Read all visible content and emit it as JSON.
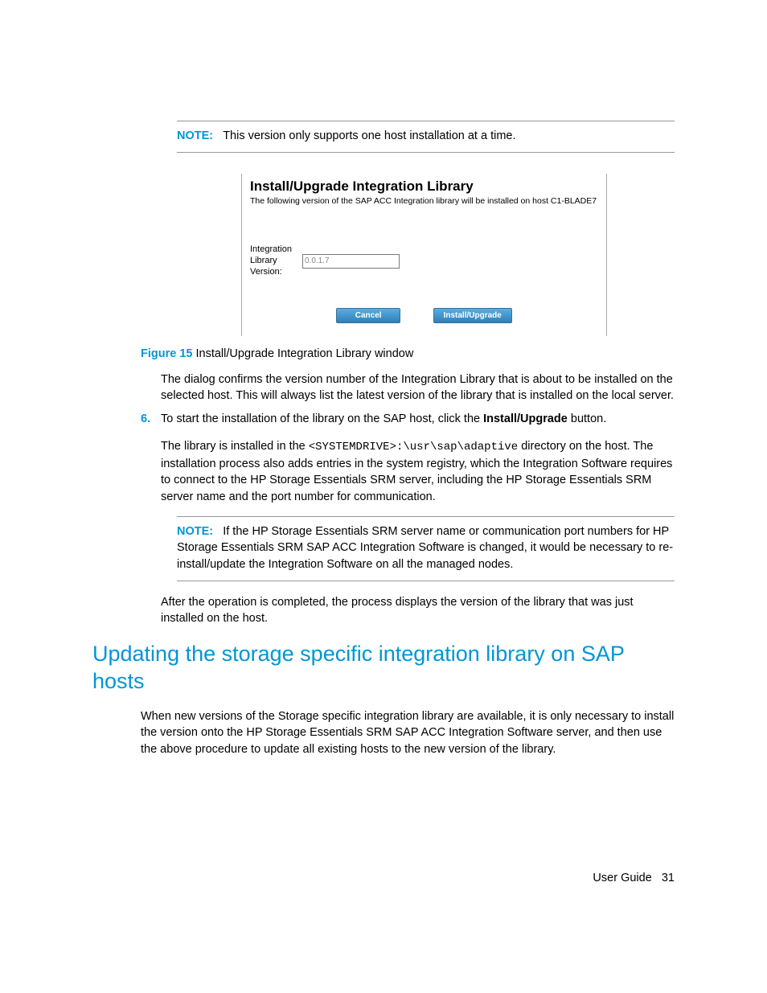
{
  "note1": {
    "label": "NOTE:",
    "text": "This version only supports one host installation at a time."
  },
  "figure": {
    "title": "Install/Upgrade Integration Library",
    "subtitle": "The following version of the SAP ACC Integration library will be installed on host C1-BLADE7",
    "field_label": "Integration Library Version:",
    "field_value": "0.0.1.7",
    "cancel_btn": "Cancel",
    "install_btn": "Install/Upgrade"
  },
  "caption": {
    "label": "Figure 15",
    "text": "Install/Upgrade Integration Library window"
  },
  "para_confirm": "The dialog confirms the version number of the Integration Library that is about to be installed on the selected host. This will always list the latest version of the library that is installed on the local server.",
  "step6": {
    "num": "6.",
    "text_a": "To start the installation of the library on the SAP host, click the ",
    "bold": "Install/Upgrade",
    "text_b": " button."
  },
  "para_install_a": "The library is installed in the ",
  "para_install_code": "<SYSTEMDRIVE>:\\usr\\sap\\adaptive",
  "para_install_b": " directory on the host. The installation process also adds entries in the system registry, which the Integration Software requires to connect to the HP Storage Essentials SRM server, including the HP Storage Essentials SRM server name and the port number for communication.",
  "note2": {
    "label": "NOTE:",
    "text": "If the HP Storage Essentials SRM server name or communication port numbers for HP Storage Essentials SRM SAP ACC Integration Software is changed, it would be necessary to re-install/update the Integration Software on all the managed nodes."
  },
  "para_after": "After the operation is completed, the process displays the version of the library that was just installed on the host.",
  "heading": "Updating the storage specific integration library on SAP hosts",
  "para_update": "When new versions of the Storage specific integration library are available, it is only necessary to install the version onto the HP Storage Essentials SRM SAP ACC Integration Software server, and then use the above procedure to update all existing hosts to the new version of the library.",
  "footer": {
    "doc": "User Guide",
    "page": "31"
  }
}
